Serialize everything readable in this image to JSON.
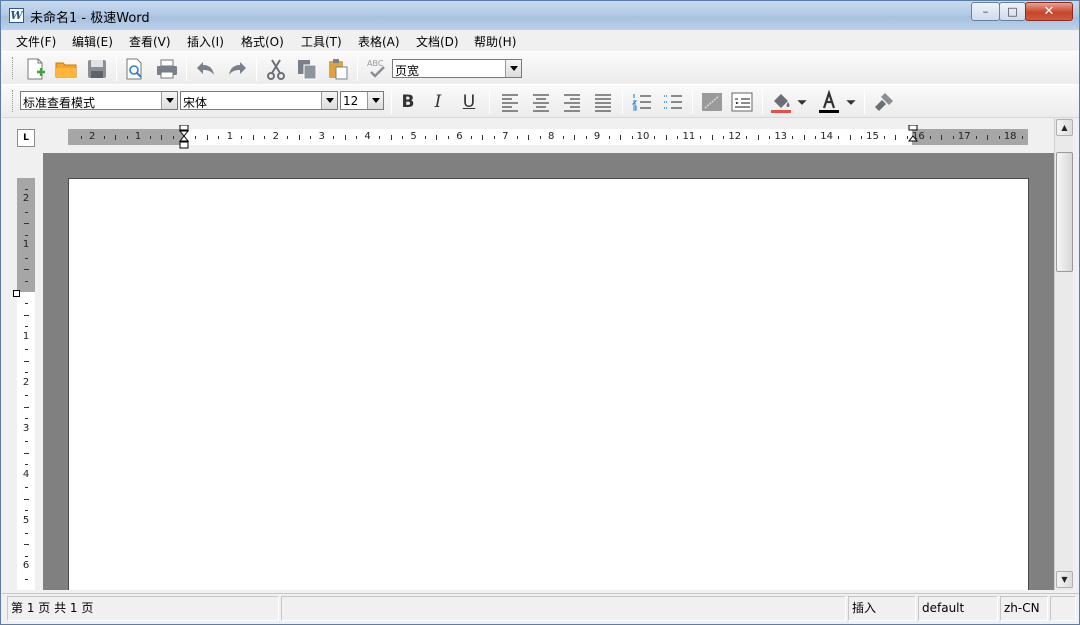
{
  "window": {
    "title": "未命名1 - 极速Word",
    "minimize_glyph": "–",
    "maximize_glyph": "□",
    "close_glyph": "✕"
  },
  "menu": {
    "items": [
      "文件(F)",
      "编辑(E)",
      "查看(V)",
      "插入(I)",
      "格式(O)",
      "工具(T)",
      "表格(A)",
      "文档(D)",
      "帮助(H)"
    ]
  },
  "toolbar": {
    "zoom": "页宽",
    "spell_check_label": "ABC",
    "icons": [
      "new-document-icon",
      "open-folder-icon",
      "save-icon",
      "print-preview-icon",
      "print-icon",
      "undo-icon",
      "redo-icon",
      "cut-icon",
      "copy-icon",
      "paste-icon",
      "spell-check-icon"
    ]
  },
  "format_toolbar": {
    "style": "标准查看模式",
    "font": "宋体",
    "size": "12",
    "bold": "B",
    "italic": "I",
    "underline": "U",
    "highlight_color": "#e0524a",
    "font_color": "#000000"
  },
  "ruler": {
    "tab_selector": "L",
    "h_numbers_left_margin": [
      "2",
      "1"
    ],
    "h_numbers": [
      "1",
      "2",
      "3",
      "4",
      "5",
      "6",
      "7",
      "8",
      "9",
      "10",
      "11",
      "12",
      "13",
      "14",
      "15",
      "16"
    ],
    "h_numbers_right_margin": [
      "17",
      "18"
    ],
    "v_numbers_margin": [
      "2",
      "1"
    ],
    "v_numbers": [
      "1",
      "2",
      "3",
      "4",
      "5",
      "6"
    ]
  },
  "scrollbar": {
    "up_glyph": "▲",
    "down_glyph": "▼"
  },
  "status": {
    "page": "第 1 页  共 1 页",
    "mode": "插入",
    "style": "default",
    "language": "zh-CN"
  }
}
